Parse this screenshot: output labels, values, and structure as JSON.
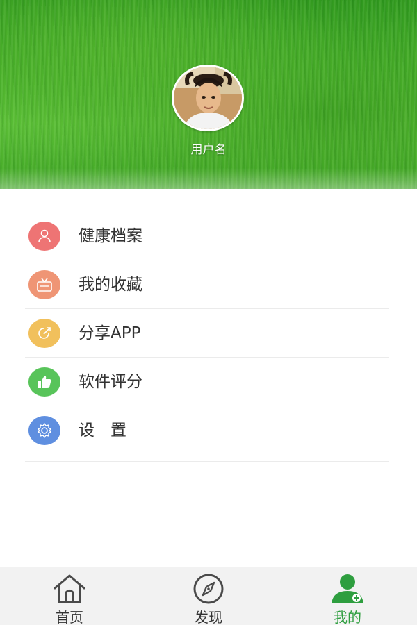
{
  "header": {
    "username": "用户名"
  },
  "menu": {
    "items": [
      {
        "label": "健康档案",
        "icon": "person-icon",
        "color": "#ee7474"
      },
      {
        "label": "我的收藏",
        "icon": "tv-icon",
        "color": "#ef9575"
      },
      {
        "label": "分享APP",
        "icon": "share-icon",
        "color": "#f1c05c"
      },
      {
        "label": "软件评分",
        "icon": "thumbs-up-icon",
        "color": "#58c45a"
      },
      {
        "label": "设　置",
        "icon": "settings-icon",
        "color": "#5f8fe0"
      }
    ]
  },
  "tabbar": {
    "tabs": [
      {
        "label": "首页",
        "icon": "home-icon",
        "active": false
      },
      {
        "label": "发现",
        "icon": "compass-icon",
        "active": false
      },
      {
        "label": "我的",
        "icon": "user-icon",
        "active": true
      }
    ],
    "active_color": "#2e9e3f"
  }
}
